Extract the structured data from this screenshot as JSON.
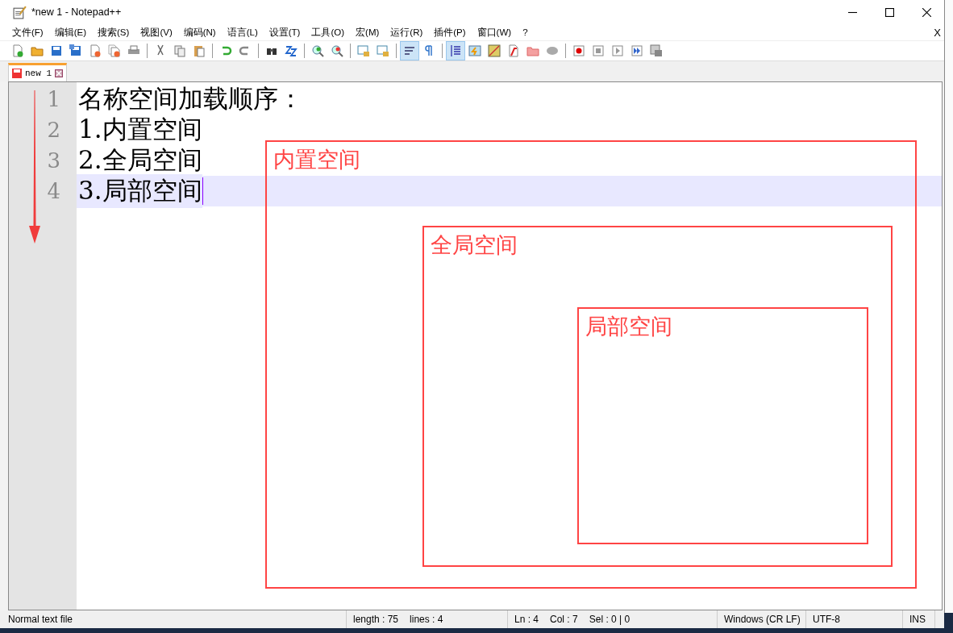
{
  "window": {
    "title": "*new 1 - Notepad++"
  },
  "menu": {
    "items": [
      "文件(F)",
      "编辑(E)",
      "搜索(S)",
      "视图(V)",
      "编码(N)",
      "语言(L)",
      "设置(T)",
      "工具(O)",
      "宏(M)",
      "运行(R)",
      "插件(P)",
      "窗口(W)",
      "?"
    ],
    "close_glyph": "X"
  },
  "toolbar": [
    {
      "kind": "new",
      "on": false
    },
    {
      "kind": "open",
      "on": false
    },
    {
      "kind": "save",
      "on": false
    },
    {
      "kind": "saveall",
      "on": false
    },
    {
      "kind": "close",
      "on": false
    },
    {
      "kind": "closeall",
      "on": false
    },
    {
      "kind": "print",
      "on": false
    },
    {
      "kind": "sep"
    },
    {
      "kind": "cut",
      "on": false
    },
    {
      "kind": "copy",
      "on": false
    },
    {
      "kind": "paste",
      "on": false
    },
    {
      "kind": "sep"
    },
    {
      "kind": "undo",
      "on": false
    },
    {
      "kind": "redo",
      "on": false
    },
    {
      "kind": "sep"
    },
    {
      "kind": "find",
      "on": false
    },
    {
      "kind": "replace",
      "on": false
    },
    {
      "kind": "sep"
    },
    {
      "kind": "zoomin",
      "on": false
    },
    {
      "kind": "zoomout",
      "on": false
    },
    {
      "kind": "sep"
    },
    {
      "kind": "syncv",
      "on": false
    },
    {
      "kind": "synch",
      "on": false
    },
    {
      "kind": "sep"
    },
    {
      "kind": "wrap",
      "on": true
    },
    {
      "kind": "pilcrow",
      "on": false
    },
    {
      "kind": "sep"
    },
    {
      "kind": "indent",
      "on": true
    },
    {
      "kind": "lang",
      "on": false
    },
    {
      "kind": "map",
      "on": false
    },
    {
      "kind": "func",
      "on": false
    },
    {
      "kind": "folder",
      "on": false
    },
    {
      "kind": "monitor",
      "on": false
    },
    {
      "kind": "sep"
    },
    {
      "kind": "record",
      "on": false
    },
    {
      "kind": "stop",
      "on": false
    },
    {
      "kind": "play",
      "on": false
    },
    {
      "kind": "playmulti",
      "on": false
    },
    {
      "kind": "saverec",
      "on": false
    }
  ],
  "tabs": [
    {
      "label": "new 1",
      "selected": true,
      "modified": true
    }
  ],
  "editor": {
    "lines": [
      {
        "number": "1",
        "text": "名称空间加载顺序：",
        "current": false
      },
      {
        "number": "2",
        "text": "1.内置空间",
        "current": false
      },
      {
        "number": "3",
        "text": "2.全局空间",
        "current": false
      },
      {
        "number": "4",
        "text": "3.局部空间",
        "current": true
      }
    ]
  },
  "annotation": {
    "label": "内置空间",
    "children": [
      {
        "label": "全局空间",
        "children": [
          {
            "label": "局部空间"
          }
        ]
      }
    ]
  },
  "status_bar": {
    "doc_type": "Normal text file",
    "length": "length : 75",
    "lines": "lines : 4",
    "ln": "Ln : 4",
    "col": "Col : 7",
    "sel": "Sel : 0 | 0",
    "eol": "Windows (CR LF)",
    "encoding": "UTF-8",
    "mode": "INS"
  }
}
